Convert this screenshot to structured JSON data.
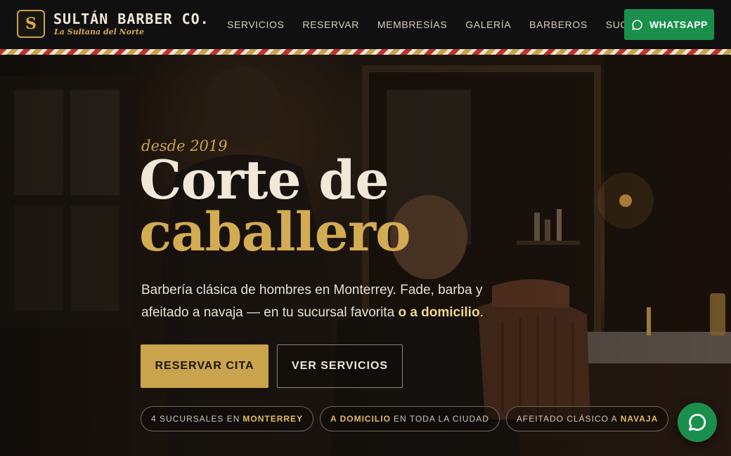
{
  "brand": {
    "logo_letter": "S",
    "name": "SULTÁN BARBER CO.",
    "tagline": "La Sultana del Norte"
  },
  "nav": {
    "items": [
      {
        "label": "SERVICIOS"
      },
      {
        "label": "RESERVAR"
      },
      {
        "label": "MEMBRESÍAS"
      },
      {
        "label": "GALERÍA"
      },
      {
        "label": "BARBEROS"
      },
      {
        "label": "SUCURSALES"
      }
    ],
    "whatsapp_label": "WHATSAPP"
  },
  "hero": {
    "eyebrow": "desde 2019",
    "headline_line1": "Corte de",
    "headline_line2": "caballero",
    "lead_text": "Barbería clásica de hombres en Monterrey. Fade, barba y afeitado a navaja — en tu sucursal favorita ",
    "lead_highlight": "o a domicilio",
    "lead_end": ".",
    "primary_button": "RESERVAR CITA",
    "secondary_button": "VER SERVICIOS"
  },
  "pills": [
    {
      "pre": "4 SUCURSALES EN",
      "strong": "MONTERREY",
      "post": ""
    },
    {
      "pre": "",
      "strong": "A DOMICILIO",
      "post": "EN TODA LA CIUDAD"
    },
    {
      "pre": "AFEITADO CLÁSICO A",
      "strong": "NAVAJA",
      "post": ""
    }
  ],
  "icons": {
    "whatsapp_header": "whatsapp-icon",
    "whatsapp_fab": "whatsapp-icon"
  },
  "colors": {
    "accent_gold": "#c9a44c",
    "whatsapp_green": "#1a8f4c",
    "header_bg": "#101010",
    "stripe_red": "#c0322e"
  }
}
